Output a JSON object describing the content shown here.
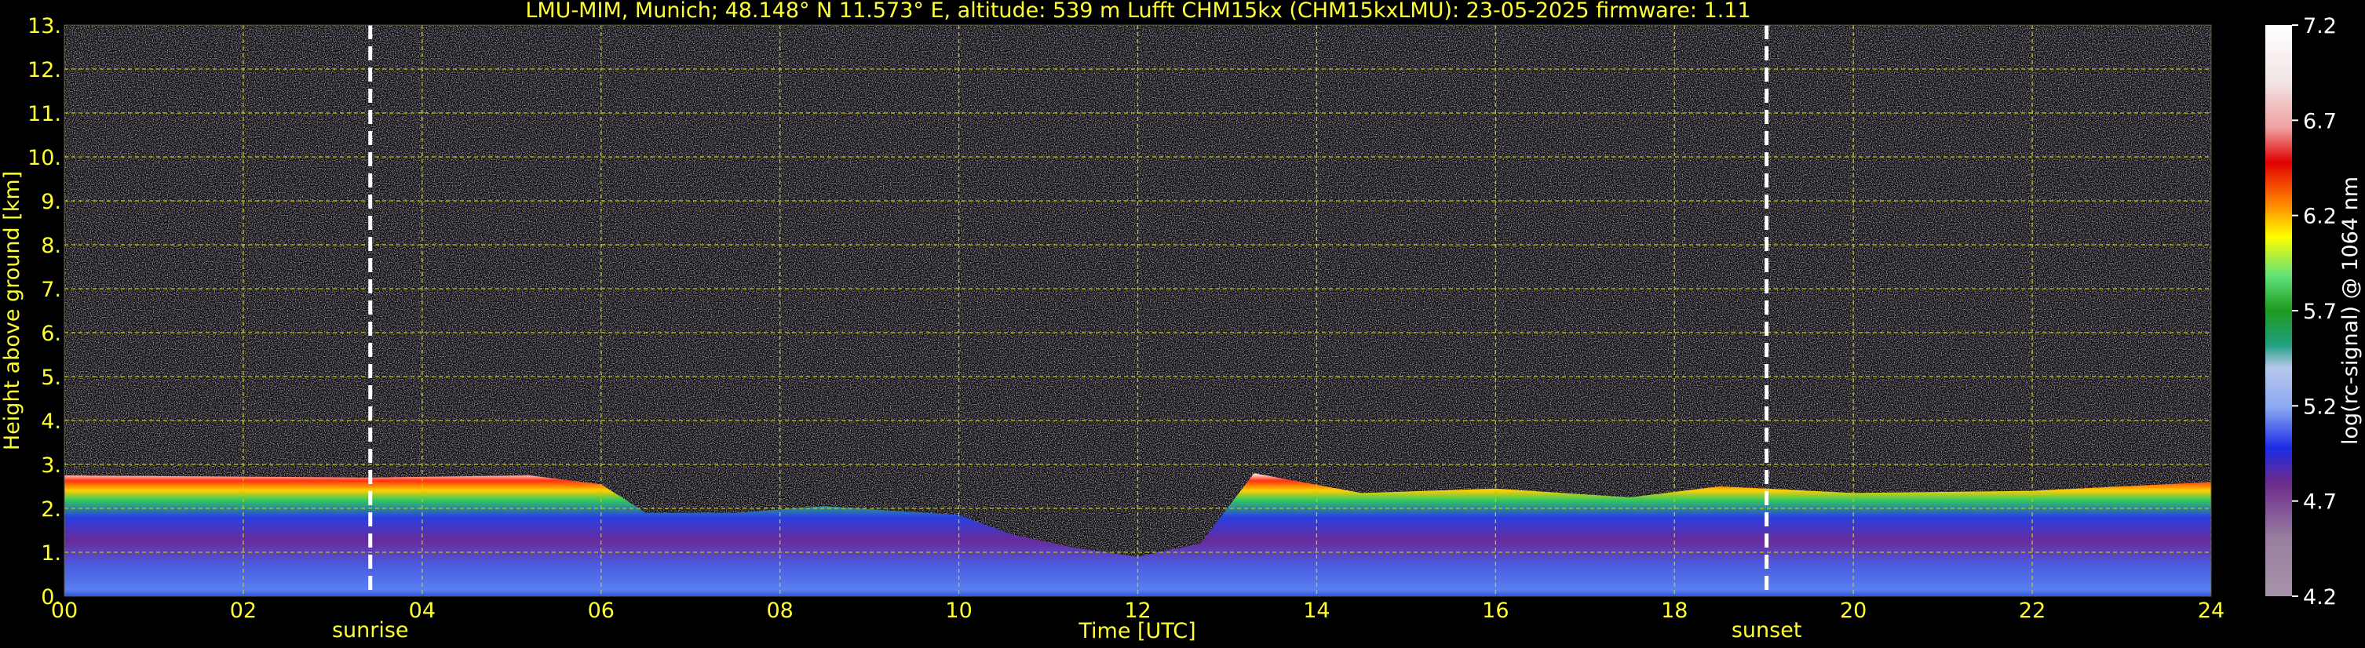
{
  "chart_data": {
    "type": "heatmap",
    "title": "LMU-MIM, Munich; 48.148° N 11.573° E, altitude: 539 m    Lufft CHM15kx (CHM15kxLMU): 23-05-2025    firmware: 1.11",
    "xlabel": "Time [UTC]",
    "ylabel": "Height above ground [km]",
    "xlim": [
      0,
      24
    ],
    "ylim": [
      0,
      13
    ],
    "xticks": [
      "00",
      "02",
      "04",
      "06",
      "08",
      "10",
      "12",
      "14",
      "16",
      "18",
      "20",
      "22",
      "24"
    ],
    "yticks": [
      "0.",
      "1.",
      "2.",
      "3.",
      "4.",
      "5.",
      "6.",
      "7.",
      "8.",
      "9.",
      "10.",
      "11.",
      "12.",
      "13."
    ],
    "grid": true,
    "markers": [
      {
        "name": "sunrise",
        "x": 3.42
      },
      {
        "name": "sunset",
        "x": 19.03
      }
    ],
    "colorbar": {
      "label": "log(rc-signal) @ 1064 nm",
      "ticks": [
        "4.2",
        "4.7",
        "5.2",
        "5.7",
        "6.2",
        "6.7",
        "7.2"
      ],
      "range": [
        4.2,
        7.2
      ]
    },
    "boundary_layer_top_km": [
      [
        0,
        2.75
      ],
      [
        3.42,
        2.7
      ],
      [
        5.2,
        2.75
      ],
      [
        6.0,
        2.55
      ],
      [
        6.5,
        1.9
      ],
      [
        7.5,
        1.9
      ],
      [
        8.5,
        2.05
      ],
      [
        10.0,
        1.85
      ],
      [
        10.6,
        1.4
      ],
      [
        11.3,
        1.1
      ],
      [
        12.0,
        0.9
      ],
      [
        12.7,
        1.2
      ],
      [
        13.3,
        2.8
      ],
      [
        14.5,
        2.35
      ],
      [
        16.0,
        2.45
      ],
      [
        17.5,
        2.25
      ],
      [
        18.5,
        2.5
      ],
      [
        19.03,
        2.45
      ],
      [
        20.0,
        2.35
      ],
      [
        22.0,
        2.4
      ],
      [
        24.0,
        2.6
      ]
    ]
  },
  "colors": {
    "axis_text": "#ffff33",
    "grid": "#c8c800",
    "background": "#000000",
    "colormap": [
      "#a594a8",
      "#9a7fa0",
      "#8b5f95",
      "#6c2a8c",
      "#3a0aa0",
      "#1a2ce6",
      "#4a6cf0",
      "#8aa8f2",
      "#b8c8ec",
      "#20a080",
      "#1e9a1e",
      "#3cc864",
      "#60e07a",
      "#c8f03c",
      "#ffff00",
      "#ffc000",
      "#ff8000",
      "#ff4000",
      "#e00000",
      "#f0a0a0",
      "#f2e4e4",
      "#ffffff"
    ]
  }
}
